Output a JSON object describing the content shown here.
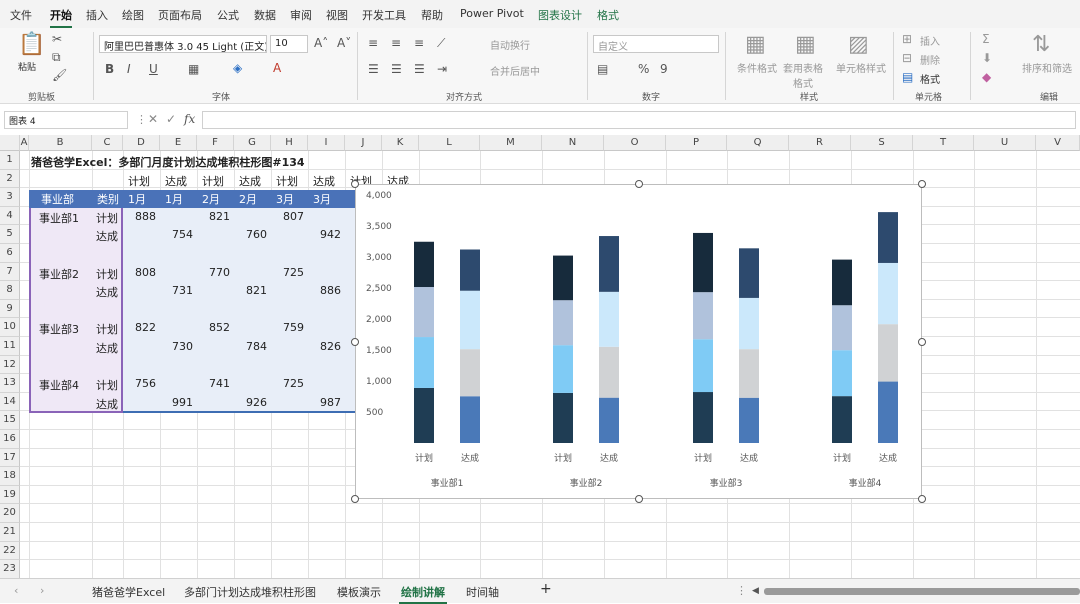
{
  "ribbon_tabs": [
    "文件",
    "开始",
    "插入",
    "绘图",
    "页面布局",
    "公式",
    "数据",
    "审阅",
    "视图",
    "开发工具",
    "帮助",
    "Power Pivot",
    "图表设计",
    "格式"
  ],
  "ribbon": {
    "paste_label": "粘贴",
    "font_name": "阿里巴巴普惠体 3.0 45 Light (正文)",
    "font_size": "10",
    "wrap_text": "自动换行",
    "merge_center": "合并后居中",
    "number_format": "自定义",
    "conditional_format": "条件格式",
    "table_format": "套用表格格式",
    "cell_style": "单元格样式",
    "insert": "插入",
    "delete": "删除",
    "format": "格式",
    "sort_filter": "排序和筛选",
    "groups": {
      "clipboard": "剪贴板",
      "font": "字体",
      "alignment": "对齐方式",
      "number": "数字",
      "styles": "样式",
      "cells": "单元格",
      "editing": "编辑"
    }
  },
  "formula_bar": {
    "name_box": "图表 4",
    "fx": "fx",
    "content": ""
  },
  "columns": [
    "A",
    "B",
    "C",
    "D",
    "E",
    "F",
    "G",
    "H",
    "I",
    "J",
    "K",
    "L",
    "M",
    "N",
    "O",
    "P",
    "Q",
    "R",
    "S",
    "T",
    "U",
    "V"
  ],
  "rows": [
    "1",
    "2",
    "3",
    "4",
    "5",
    "6",
    "7",
    "8",
    "9",
    "10",
    "11",
    "12",
    "13",
    "14",
    "15",
    "16",
    "17",
    "18",
    "19",
    "20",
    "21",
    "22",
    "23"
  ],
  "sheet": {
    "title": "猪爸爸学Excel：多部门月度计划达成堆积柱形图#134",
    "row2_labels": [
      "计划",
      "达成",
      "计划",
      "达成",
      "计划",
      "达成",
      "计划",
      "达成"
    ],
    "header_row": [
      "事业部",
      "类别",
      "1月",
      "1月",
      "2月",
      "2月",
      "3月",
      "3月"
    ],
    "departments": [
      "事业部1",
      "事业部2",
      "事业部3",
      "事业部4"
    ],
    "type_plan": "计划",
    "type_actual": "达成",
    "plan_values": [
      [
        "888",
        "821",
        "807"
      ],
      [
        "808",
        "770",
        "725"
      ],
      [
        "822",
        "852",
        "759"
      ],
      [
        "756",
        "741",
        "725"
      ]
    ],
    "actual_values": [
      [
        "754",
        "760",
        "942"
      ],
      [
        "731",
        "821",
        "886"
      ],
      [
        "730",
        "784",
        "826"
      ],
      [
        "991",
        "926",
        "987"
      ]
    ]
  },
  "sheet_tabs": [
    "猪爸爸学Excel",
    "多部门计划达成堆积柱形图",
    "模板演示",
    "绘制讲解",
    "时间轴"
  ],
  "active_sheet": "绘制讲解",
  "chart_data": {
    "type": "bar",
    "stacked": true,
    "categories": [
      "计划",
      "达成",
      "计划",
      "达成",
      "计划",
      "达成",
      "计划",
      "达成"
    ],
    "groups": [
      "事业部1",
      "事业部2",
      "事业部3",
      "事业部4"
    ],
    "ylim": [
      0,
      4000
    ],
    "yticks": [
      "4,000",
      "3,500",
      "3,000",
      "2,500",
      "2,000",
      "1,500",
      "1,000",
      "500"
    ],
    "series": [
      {
        "values": [
          888,
          754,
          808,
          731,
          822,
          730,
          756,
          991
        ]
      },
      {
        "values": [
          821,
          760,
          770,
          821,
          852,
          784,
          741,
          926
        ]
      },
      {
        "values": [
          807,
          942,
          725,
          886,
          759,
          826,
          725,
          987
        ]
      },
      {
        "values": [
          730,
          665,
          720,
          900,
          955,
          800,
          736,
          820
        ]
      }
    ],
    "colors_plan": [
      "#1f3d54",
      "#7fcbf5",
      "#b0c2dc",
      "#172b3c"
    ],
    "colors_actual": [
      "#4a79b8",
      "#d0d2d4",
      "#cbe8fb",
      "#2d4a6e"
    ]
  }
}
